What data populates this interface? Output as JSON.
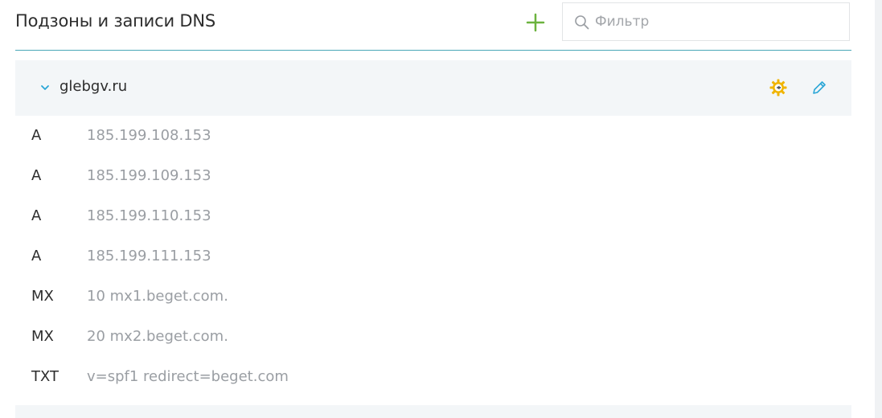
{
  "header": {
    "title": "Подзоны и записи DNS",
    "add_icon": "plus-icon",
    "filter": {
      "placeholder": "Фильтр",
      "value": "",
      "icon": "search-icon"
    }
  },
  "zone": {
    "name": "glebgv.ru",
    "expanded": true,
    "expand_icon": "chevron-down-icon",
    "actions": [
      {
        "icon": "gear-icon"
      },
      {
        "icon": "pencil-icon"
      }
    ],
    "records": [
      {
        "type": "A",
        "value": "185.199.108.153"
      },
      {
        "type": "A",
        "value": "185.199.109.153"
      },
      {
        "type": "A",
        "value": "185.199.110.153"
      },
      {
        "type": "A",
        "value": "185.199.111.153"
      },
      {
        "type": "MX",
        "value": "10 mx1.beget.com."
      },
      {
        "type": "MX",
        "value": "20 mx2.beget.com."
      },
      {
        "type": "TXT",
        "value": "v=spf1 redirect=beget.com"
      }
    ]
  },
  "colors": {
    "accent_green": "#6cb33f",
    "accent_teal": "#4aa8b8",
    "gear_yellow": "#f0b400",
    "edit_blue": "#2aa6d6"
  }
}
